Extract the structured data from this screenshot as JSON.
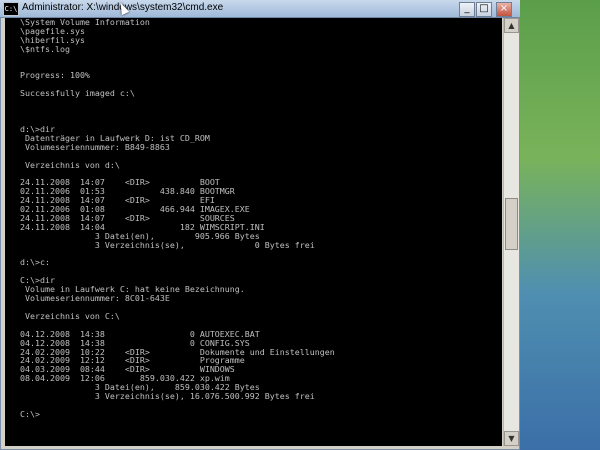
{
  "window": {
    "title": "Administrator: X:\\windows\\system32\\cmd.exe",
    "icon_label": "C:\\",
    "buttons": {
      "minimize": "_",
      "maximize": "□",
      "close": "×"
    }
  },
  "console": {
    "lines": [
      "\\System Volume Information",
      "\\pagefile.sys",
      "\\hiberfil.sys",
      "\\$ntfs.log",
      "",
      "",
      "Progress: 100%",
      "",
      "Successfully imaged c:\\",
      "",
      "",
      "",
      "d:\\>dir",
      " Datenträger in Laufwerk D: ist CD_ROM",
      " Volumeseriennummer: B849-8863",
      "",
      " Verzeichnis von d:\\",
      "",
      "24.11.2008  14:07    <DIR>          BOOT",
      "02.11.2006  01:53           438.840 BOOTMGR",
      "24.11.2008  14:07    <DIR>          EFI",
      "02.11.2006  01:08           466.944 IMAGEX.EXE",
      "24.11.2008  14:07    <DIR>          SOURCES",
      "24.11.2008  14:04               182 WIMSCRIPT.INI",
      "               3 Datei(en),        905.966 Bytes",
      "               3 Verzeichnis(se),              0 Bytes frei",
      "",
      "d:\\>c:",
      "",
      "C:\\>dir",
      " Volume in Laufwerk C: hat keine Bezeichnung.",
      " Volumeseriennummer: 8C01-643E",
      "",
      " Verzeichnis von C:\\",
      "",
      "04.12.2008  14:38                 0 AUTOEXEC.BAT",
      "04.12.2008  14:38                 0 CONFIG.SYS",
      "24.02.2009  10:22    <DIR>          Dokumente und Einstellungen",
      "24.02.2009  12:12    <DIR>          Programme",
      "04.03.2009  08:44    <DIR>          WINDOWS",
      "08.04.2009  12:06       859.030.422 xp.wim",
      "               3 Datei(en),    859.030.422 Bytes",
      "               3 Verzeichnis(se), 16.076.500.992 Bytes frei",
      "",
      "C:\\>"
    ]
  },
  "scrollbar": {
    "up": "▲",
    "down": "▼"
  }
}
